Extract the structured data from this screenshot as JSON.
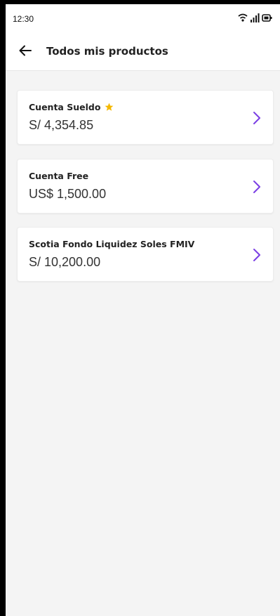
{
  "status_bar": {
    "time": "12:30",
    "icons": [
      "wifi-icon",
      "signal-icon",
      "battery-icon"
    ]
  },
  "header": {
    "title": "Todos mis productos",
    "back_icon": "arrow-left-icon"
  },
  "products": [
    {
      "name": "Cuenta Sueldo",
      "amount": "S/ 4,354.85",
      "favorite": true
    },
    {
      "name": "Cuenta Free",
      "amount": "US$ 1,500.00",
      "favorite": false
    },
    {
      "name": "Scotia Fondo Liquidez Soles FMIV",
      "amount": "S/ 10,200.00",
      "favorite": false
    }
  ],
  "colors": {
    "accent": "#7b3fe4",
    "star": "#f5b800",
    "background": "#f4f4f4"
  }
}
